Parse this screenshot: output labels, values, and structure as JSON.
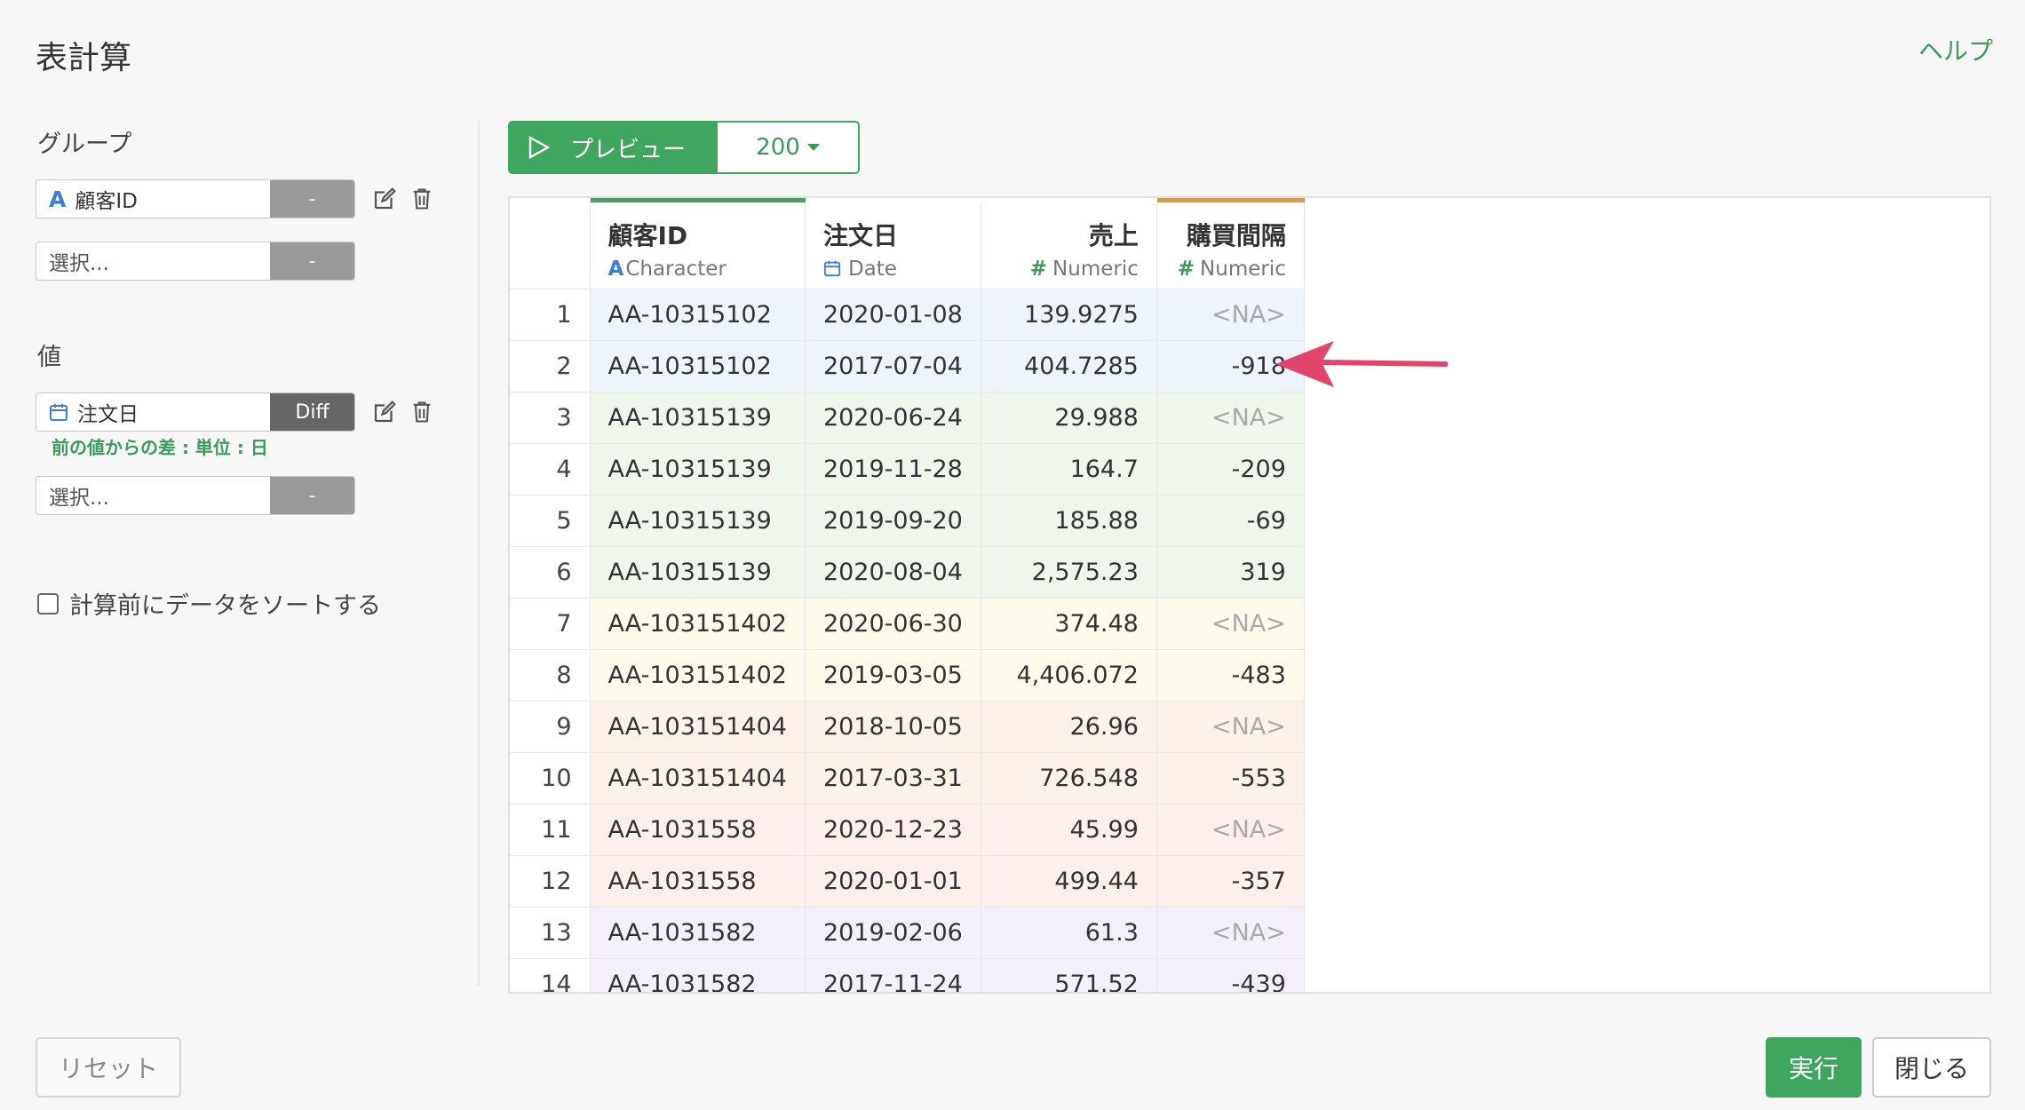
{
  "dialog": {
    "title": "表計算",
    "help": "ヘルプ"
  },
  "group": {
    "label": "グループ",
    "row1": {
      "value": "顧客ID",
      "button": "-"
    },
    "row2": {
      "placeholder": "選択...",
      "button": "-"
    }
  },
  "values": {
    "label": "値",
    "row1": {
      "value": "注文日",
      "button": "Diff",
      "note": "前の値からの差 : 単位 : 日"
    },
    "row2": {
      "placeholder": "選択...",
      "button": "-"
    }
  },
  "sort_option": {
    "label": "計算前にデータをソートする",
    "checked": false
  },
  "preview": {
    "label": "プレビュー",
    "count": "200"
  },
  "table": {
    "columns": [
      {
        "name": "顧客ID",
        "type": "Character"
      },
      {
        "name": "注文日",
        "type": "Date"
      },
      {
        "name": "売上",
        "type": "Numeric"
      },
      {
        "name": "購買間隔",
        "type": "Numeric"
      }
    ],
    "rows": [
      {
        "n": "1",
        "id": "AA-10315102",
        "date": "2020-01-08",
        "sales": "139.9275",
        "interval": "<NA>",
        "color": "#eef4fc"
      },
      {
        "n": "2",
        "id": "AA-10315102",
        "date": "2017-07-04",
        "sales": "404.7285",
        "interval": "-918",
        "color": "#eef4fc"
      },
      {
        "n": "3",
        "id": "AA-10315139",
        "date": "2020-06-24",
        "sales": "29.988",
        "interval": "<NA>",
        "color": "#eff7ec"
      },
      {
        "n": "4",
        "id": "AA-10315139",
        "date": "2019-11-28",
        "sales": "164.7",
        "interval": "-209",
        "color": "#eff7ec"
      },
      {
        "n": "5",
        "id": "AA-10315139",
        "date": "2019-09-20",
        "sales": "185.88",
        "interval": "-69",
        "color": "#eff7ec"
      },
      {
        "n": "6",
        "id": "AA-10315139",
        "date": "2020-08-04",
        "sales": "2,575.23",
        "interval": "319",
        "color": "#eff7ec"
      },
      {
        "n": "7",
        "id": "AA-103151402",
        "date": "2020-06-30",
        "sales": "374.48",
        "interval": "<NA>",
        "color": "#fdfcec"
      },
      {
        "n": "8",
        "id": "AA-103151402",
        "date": "2019-03-05",
        "sales": "4,406.072",
        "interval": "-483",
        "color": "#fdfcec"
      },
      {
        "n": "9",
        "id": "AA-103151404",
        "date": "2018-10-05",
        "sales": "26.96",
        "interval": "<NA>",
        "color": "#fdf2ea"
      },
      {
        "n": "10",
        "id": "AA-103151404",
        "date": "2017-03-31",
        "sales": "726.548",
        "interval": "-553",
        "color": "#fdf2ea"
      },
      {
        "n": "11",
        "id": "AA-1031558",
        "date": "2020-12-23",
        "sales": "45.99",
        "interval": "<NA>",
        "color": "#fcefec"
      },
      {
        "n": "12",
        "id": "AA-1031558",
        "date": "2020-01-01",
        "sales": "499.44",
        "interval": "-357",
        "color": "#fcefec"
      },
      {
        "n": "13",
        "id": "AA-1031582",
        "date": "2019-02-06",
        "sales": "61.3",
        "interval": "<NA>",
        "color": "#f4f0fb"
      },
      {
        "n": "14",
        "id": "AA-1031582",
        "date": "2017-11-24",
        "sales": "571.52",
        "interval": "-439",
        "color": "#f4f0fb"
      }
    ]
  },
  "footer": {
    "reset": "リセット",
    "run": "実行",
    "close": "閉じる"
  },
  "colors": {
    "accent": "#3ea65f",
    "arrow": "#e2456b",
    "header_bar_orange": "#e8963a"
  }
}
